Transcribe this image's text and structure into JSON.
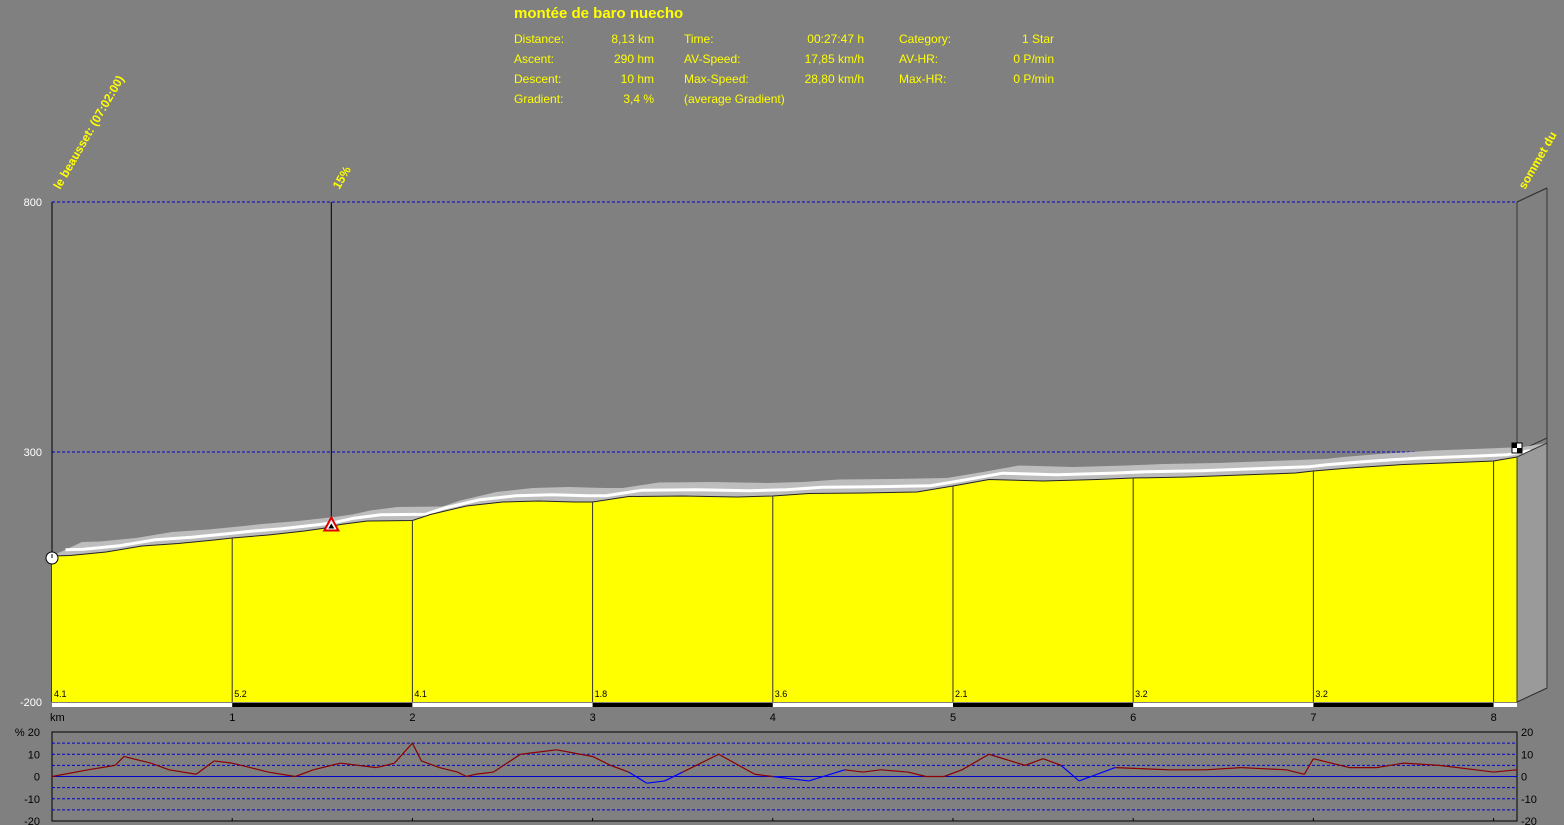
{
  "header": {
    "title": "montée de baro nuecho",
    "stats": [
      {
        "label": "Distance:",
        "value": "8,13 km"
      },
      {
        "label": "Ascent:",
        "value": "290 hm"
      },
      {
        "label": "Descent:",
        "value": "10 hm"
      },
      {
        "label": "Gradient:",
        "value": "3,4 %"
      },
      {
        "label": "Time:",
        "value": "00:27:47 h"
      },
      {
        "label": "AV-Speed:",
        "value": "17,85 km/h"
      },
      {
        "label": "Max-Speed:",
        "value": "28,80 km/h"
      },
      {
        "label": "(average Gradient)",
        "value": ""
      },
      {
        "label": "Category:",
        "value": "1 Star"
      },
      {
        "label": "AV-HR:",
        "value": "0 P/min"
      },
      {
        "label": "Max-HR:",
        "value": "0 P/min"
      }
    ]
  },
  "colors": {
    "background": "#808080",
    "fill": "#ffff00",
    "text": "#ffff00",
    "gridline": "#0000cc",
    "gradient_up": "#8b0000",
    "gradient_down": "#0000ff"
  },
  "chart_data": [
    {
      "type": "area",
      "xlabel": "km",
      "ylabel": "",
      "xlim": [
        0,
        8.13
      ],
      "ylim": [
        -200,
        800
      ],
      "y_ticks": [
        -200,
        300,
        800
      ],
      "x_ticks": [
        1,
        2,
        3,
        4,
        5,
        6,
        7,
        8
      ],
      "grid": true,
      "x": [
        0,
        0.1,
        0.3,
        0.5,
        0.7,
        0.9,
        1.0,
        1.2,
        1.4,
        1.5,
        1.6,
        1.75,
        2.0,
        2.1,
        2.3,
        2.5,
        2.7,
        2.9,
        3.0,
        3.2,
        3.5,
        3.8,
        4.0,
        4.2,
        4.5,
        4.8,
        5.0,
        5.2,
        5.5,
        5.8,
        6.0,
        6.3,
        6.6,
        6.9,
        7.0,
        7.2,
        7.5,
        7.8,
        8.0,
        8.13
      ],
      "elevation": [
        92,
        93,
        100,
        112,
        117,
        124,
        128,
        134,
        142,
        147,
        155,
        162,
        163,
        175,
        192,
        200,
        202,
        200,
        200,
        211,
        212,
        210,
        212,
        217,
        218,
        220,
        232,
        245,
        242,
        245,
        248,
        250,
        254,
        258,
        262,
        268,
        275,
        279,
        282,
        290
      ],
      "annotations": [
        {
          "x": 0,
          "label": "le beausset: (07:02:00)"
        },
        {
          "x": 1.55,
          "label": "15%"
        },
        {
          "x": 8.13,
          "label": "sommet du"
        }
      ],
      "segment_gradients": [
        {
          "x": 0,
          "label": "4.1"
        },
        {
          "x": 1,
          "label": "5.2"
        },
        {
          "x": 2,
          "label": "4.1"
        },
        {
          "x": 3,
          "label": "1.8"
        },
        {
          "x": 4,
          "label": "3.6"
        },
        {
          "x": 5,
          "label": "2.1"
        },
        {
          "x": 6,
          "label": "3.2"
        },
        {
          "x": 7,
          "label": "3.2"
        }
      ]
    },
    {
      "type": "line",
      "ylabel": "%",
      "ylim": [
        -20,
        20
      ],
      "y_ticks": [
        -20,
        -10,
        0,
        10,
        20
      ],
      "x": [
        0,
        0.2,
        0.35,
        0.4,
        0.55,
        0.65,
        0.8,
        0.9,
        1.0,
        1.1,
        1.2,
        1.35,
        1.45,
        1.55,
        1.6,
        1.7,
        1.8,
        1.9,
        2.0,
        2.05,
        2.15,
        2.25,
        2.3,
        2.35,
        2.45,
        2.6,
        2.8,
        3.0,
        3.1,
        3.2,
        3.3,
        3.4,
        3.5,
        3.7,
        3.9,
        4.0,
        4.2,
        4.4,
        4.5,
        4.6,
        4.75,
        4.85,
        4.95,
        5.05,
        5.2,
        5.4,
        5.5,
        5.6,
        5.7,
        5.9,
        6.2,
        6.4,
        6.6,
        6.85,
        6.95,
        7.0,
        7.2,
        7.35,
        7.5,
        7.7,
        7.9,
        8.0,
        8.13
      ],
      "gradient": [
        0,
        3,
        5,
        9,
        6,
        3,
        1,
        7,
        6,
        4,
        2,
        0,
        3,
        5,
        6,
        5,
        4,
        6,
        15,
        7,
        4,
        2,
        0,
        1,
        2,
        10,
        12,
        9,
        5,
        2,
        -3,
        -2,
        2,
        10,
        1,
        0,
        -2,
        3,
        2,
        3,
        2,
        0,
        0,
        3,
        10,
        5,
        8,
        5,
        -2,
        4,
        3,
        3,
        4,
        3,
        1,
        8,
        4,
        4,
        6,
        5,
        3,
        2,
        3,
        3,
        1,
        3,
        5
      ]
    }
  ]
}
